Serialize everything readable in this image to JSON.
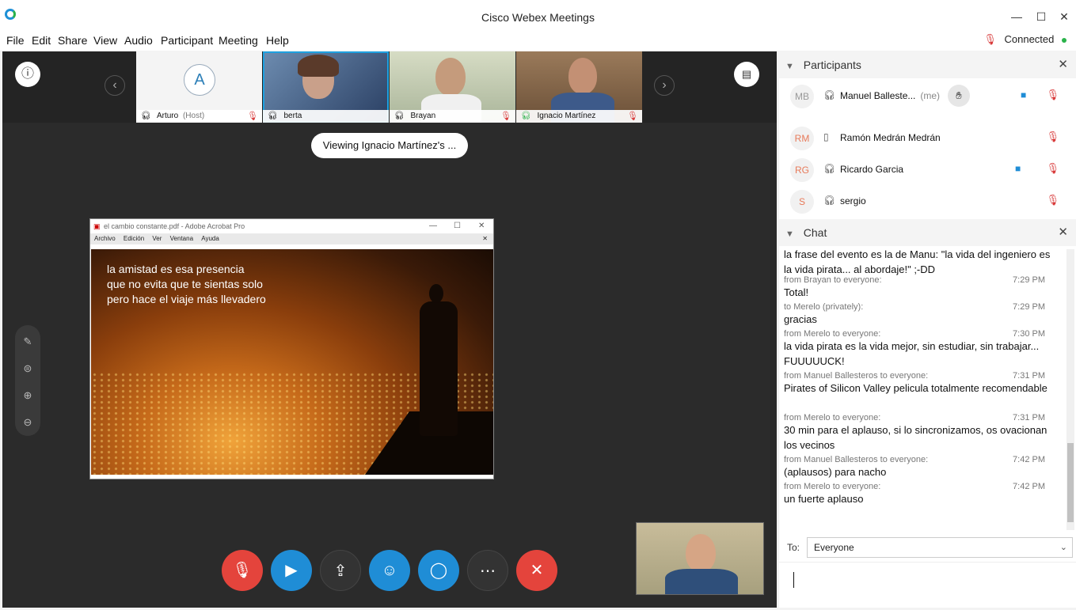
{
  "window": {
    "title": "Cisco Webex Meetings",
    "controls": [
      "—",
      "☐",
      "✕"
    ]
  },
  "menu": [
    "File",
    "Edit",
    "Share",
    "View",
    "Audio",
    "Participant",
    "Meeting",
    "Help"
  ],
  "status": {
    "text": "Connected",
    "color": "#2ab24a"
  },
  "thumbnails": [
    {
      "name": "Arturo",
      "role": "(Host)",
      "initial": "A"
    },
    {
      "name": "berta"
    },
    {
      "name": "Brayan"
    },
    {
      "name": "Ignacio Martínez"
    }
  ],
  "viewing": "Viewing Ignacio Martínez's ...",
  "shared_window": {
    "title": "el cambio constante.pdf - Adobe Acrobat Pro",
    "menu": [
      "Archivo",
      "Edición",
      "Ver",
      "Ventana",
      "Ayuda"
    ],
    "quote": [
      "la amistad es esa presencia",
      "que no evita que te sientas solo",
      "pero hace el viaje más llevadero"
    ]
  },
  "controls": {
    "mute_color": "#e4443c",
    "video_color": "#1f8dd6",
    "leave_color": "#e4443c",
    "icons": [
      "mic-muted-icon",
      "video-icon",
      "share-icon",
      "participants-icon",
      "chat-icon",
      "more-icon",
      "leave-icon"
    ]
  },
  "participants_panel": {
    "title": "Participants",
    "rows": [
      {
        "initials": "MB",
        "name": "Manuel Balleste...",
        "me": "(me)"
      },
      {
        "initials": "RM",
        "name": "Ramón Medrán Medrán"
      },
      {
        "initials": "RG",
        "name": "Ricardo Garcia"
      },
      {
        "initials": "S",
        "name": "sergio"
      }
    ]
  },
  "chat_panel": {
    "title": "Chat",
    "messages": [
      {
        "meta": "",
        "time": "",
        "text": "la frase del evento es la de Manu: \"la vida del ingeniero es la vida pirata... al abordaje!\" ;-DD"
      },
      {
        "meta": "from Brayan to everyone:",
        "time": "7:29 PM",
        "text": "Total!"
      },
      {
        "meta": "to Merelo (privately):",
        "time": "7:29 PM",
        "text": "gracias"
      },
      {
        "meta": "from Merelo to everyone:",
        "time": "7:30 PM",
        "text": "la vida pirata es la vida mejor, sin estudiar, sin trabajar... FUUUUUCK!"
      },
      {
        "meta": "from Manuel Ballesteros to everyone:",
        "time": "7:31 PM",
        "text": "Pirates of Silicon Valley pelicula totalmente recomendable"
      },
      {
        "meta": "from Merelo to everyone:",
        "time": "7:31 PM",
        "text": "30 min para el aplauso, si lo sincronizamos, os ovacionan los vecinos"
      },
      {
        "meta": "from Manuel Ballesteros to everyone:",
        "time": "7:42 PM",
        "text": "(aplausos) para nacho"
      },
      {
        "meta": "from Merelo to everyone:",
        "time": "7:42 PM",
        "text": "un fuerte aplauso"
      }
    ],
    "to_label": "To:",
    "to_value": "Everyone"
  }
}
